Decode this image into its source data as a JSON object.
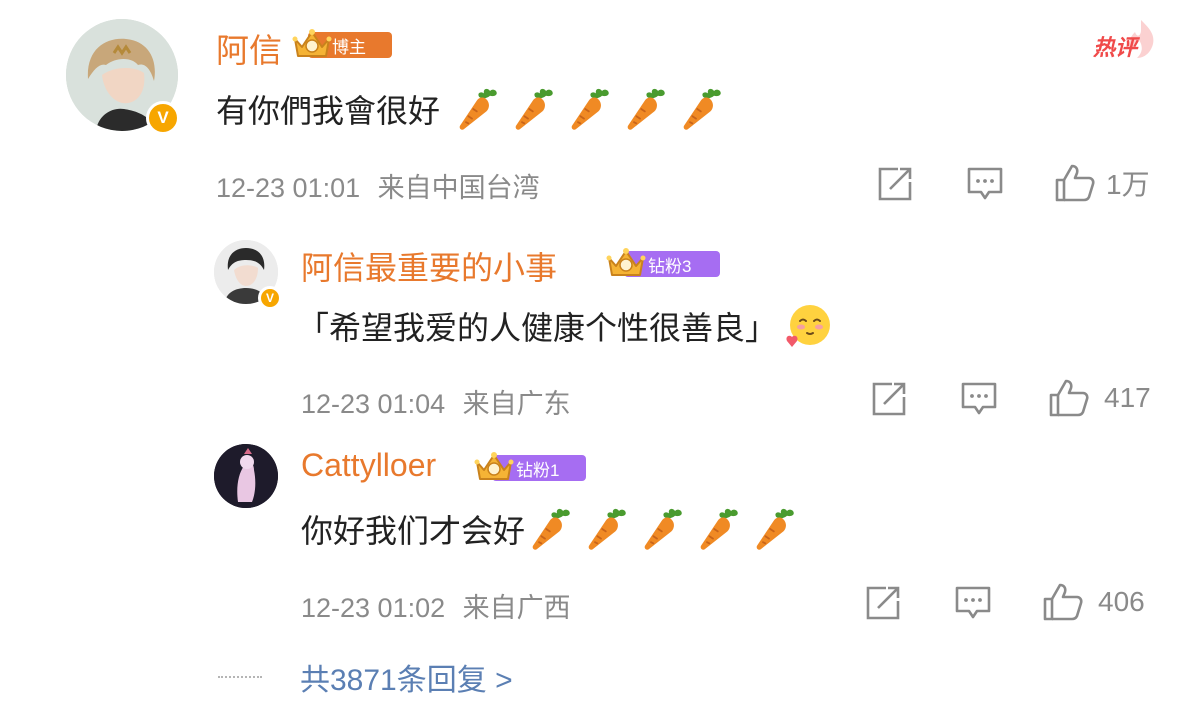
{
  "header": {
    "hot_label": "热评"
  },
  "comment": {
    "username": "阿信",
    "badge": "博主",
    "text": "有你們我會很好",
    "carrot_emojis": 5,
    "time": "12-23 01:01",
    "location": "来自中国台湾",
    "likes": "1万"
  },
  "replies": [
    {
      "username": "阿信最重要的小事",
      "badge": "钻粉3",
      "text": "「希望我爱的人健康个性很善良」",
      "emoji": "shy-blush-emoji",
      "time": "12-23 01:04",
      "location": "来自广东",
      "likes": "417"
    },
    {
      "username": "Cattylloer",
      "badge": "钻粉1",
      "text": "你好我们才会好",
      "carrot_emojis": 5,
      "time": "12-23 01:02",
      "location": "来自广西",
      "likes": "406"
    }
  ],
  "footer": {
    "more_replies": "共3871条回复 >"
  },
  "colors": {
    "accent": "#e8792d",
    "badge_orange": "#e8792d",
    "badge_purple": "#a66df2",
    "link": "#5b7fb3",
    "meta": "#8a8a8a",
    "hot": "#f04a4a"
  },
  "icons": [
    "share-icon",
    "comment-icon",
    "like-icon",
    "verified-badge-icon",
    "crown-icon",
    "carrot-emoji",
    "hot-comment-icon"
  ]
}
